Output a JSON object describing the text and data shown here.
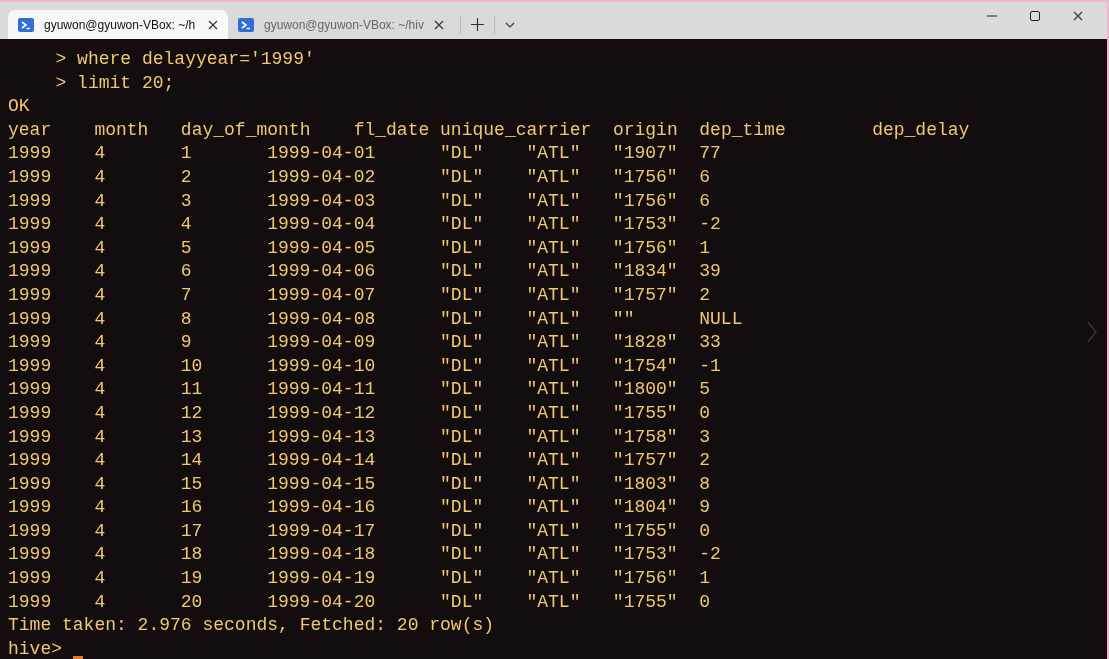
{
  "tabs": [
    {
      "title": "gyuwon@gyuwon-VBox: ~/h",
      "selected": true
    },
    {
      "title": "gyuwon@gyuwon-VBox: ~/hiv",
      "selected": false
    }
  ],
  "terminal": {
    "continuation_lines": [
      "> where delayyear='1999'",
      "> limit 20;"
    ],
    "status": "OK",
    "header_line": "year    month   day_of_month    fl_date unique_carrier  origin  dep_time        dep_delay",
    "rows": [
      [
        "1999",
        "4",
        "1",
        "1999-04-01",
        "\"DL\"",
        "\"ATL\"",
        "\"1907\"",
        "77"
      ],
      [
        "1999",
        "4",
        "2",
        "1999-04-02",
        "\"DL\"",
        "\"ATL\"",
        "\"1756\"",
        "6"
      ],
      [
        "1999",
        "4",
        "3",
        "1999-04-03",
        "\"DL\"",
        "\"ATL\"",
        "\"1756\"",
        "6"
      ],
      [
        "1999",
        "4",
        "4",
        "1999-04-04",
        "\"DL\"",
        "\"ATL\"",
        "\"1753\"",
        "-2"
      ],
      [
        "1999",
        "4",
        "5",
        "1999-04-05",
        "\"DL\"",
        "\"ATL\"",
        "\"1756\"",
        "1"
      ],
      [
        "1999",
        "4",
        "6",
        "1999-04-06",
        "\"DL\"",
        "\"ATL\"",
        "\"1834\"",
        "39"
      ],
      [
        "1999",
        "4",
        "7",
        "1999-04-07",
        "\"DL\"",
        "\"ATL\"",
        "\"1757\"",
        "2"
      ],
      [
        "1999",
        "4",
        "8",
        "1999-04-08",
        "\"DL\"",
        "\"ATL\"",
        "\"\"",
        "NULL"
      ],
      [
        "1999",
        "4",
        "9",
        "1999-04-09",
        "\"DL\"",
        "\"ATL\"",
        "\"1828\"",
        "33"
      ],
      [
        "1999",
        "4",
        "10",
        "1999-04-10",
        "\"DL\"",
        "\"ATL\"",
        "\"1754\"",
        "-1"
      ],
      [
        "1999",
        "4",
        "11",
        "1999-04-11",
        "\"DL\"",
        "\"ATL\"",
        "\"1800\"",
        "5"
      ],
      [
        "1999",
        "4",
        "12",
        "1999-04-12",
        "\"DL\"",
        "\"ATL\"",
        "\"1755\"",
        "0"
      ],
      [
        "1999",
        "4",
        "13",
        "1999-04-13",
        "\"DL\"",
        "\"ATL\"",
        "\"1758\"",
        "3"
      ],
      [
        "1999",
        "4",
        "14",
        "1999-04-14",
        "\"DL\"",
        "\"ATL\"",
        "\"1757\"",
        "2"
      ],
      [
        "1999",
        "4",
        "15",
        "1999-04-15",
        "\"DL\"",
        "\"ATL\"",
        "\"1803\"",
        "8"
      ],
      [
        "1999",
        "4",
        "16",
        "1999-04-16",
        "\"DL\"",
        "\"ATL\"",
        "\"1804\"",
        "9"
      ],
      [
        "1999",
        "4",
        "17",
        "1999-04-17",
        "\"DL\"",
        "\"ATL\"",
        "\"1755\"",
        "0"
      ],
      [
        "1999",
        "4",
        "18",
        "1999-04-18",
        "\"DL\"",
        "\"ATL\"",
        "\"1753\"",
        "-2"
      ],
      [
        "1999",
        "4",
        "19",
        "1999-04-19",
        "\"DL\"",
        "\"ATL\"",
        "\"1756\"",
        "1"
      ],
      [
        "1999",
        "4",
        "20",
        "1999-04-20",
        "\"DL\"",
        "\"ATL\"",
        "\"1755\"",
        "0"
      ]
    ],
    "summary": "Time taken: 2.976 seconds, Fetched: 20 row(s)",
    "prompt": "hive>"
  }
}
